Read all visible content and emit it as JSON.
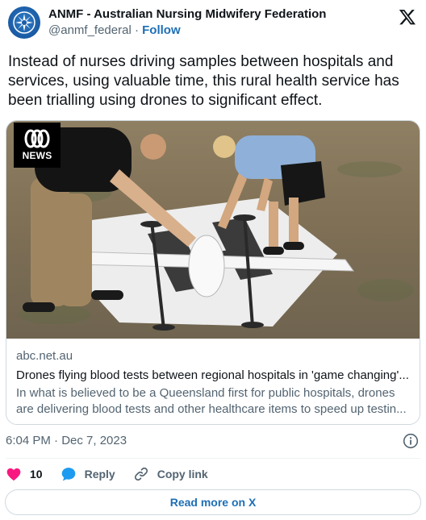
{
  "author": {
    "display_name": "ANMF - Australian Nursing Midwifery Federation",
    "handle": "@anmf_federal",
    "separator": "·",
    "follow_label": "Follow"
  },
  "tweet": {
    "text": "Instead of nurses driving samples between hospitals and services, using valuable time, this rural health service has been trialling using drones to significant effect."
  },
  "card": {
    "badge_text": "NEWS",
    "domain": "abc.net.au",
    "title": "Drones flying blood tests between regional hospitals in 'game changing'...",
    "description": "In what is believed to be a Queensland first for public hospitals, drones are delivering blood tests and other healthcare items to speed up testin..."
  },
  "timestamp": "6:04 PM · Dec 7, 2023",
  "actions": {
    "like_count": "10",
    "reply_label": "Reply",
    "copy_link_label": "Copy link"
  },
  "read_more_label": "Read more on X",
  "colors": {
    "accent": "#1d6fb5",
    "like": "#f91880",
    "reply": "#1d9bf0",
    "muted": "#536471"
  },
  "icons": [
    "anmf-logo-icon",
    "x-logo-icon",
    "abc-logo-icon",
    "info-icon",
    "heart-icon",
    "reply-bubble-icon",
    "link-icon"
  ]
}
